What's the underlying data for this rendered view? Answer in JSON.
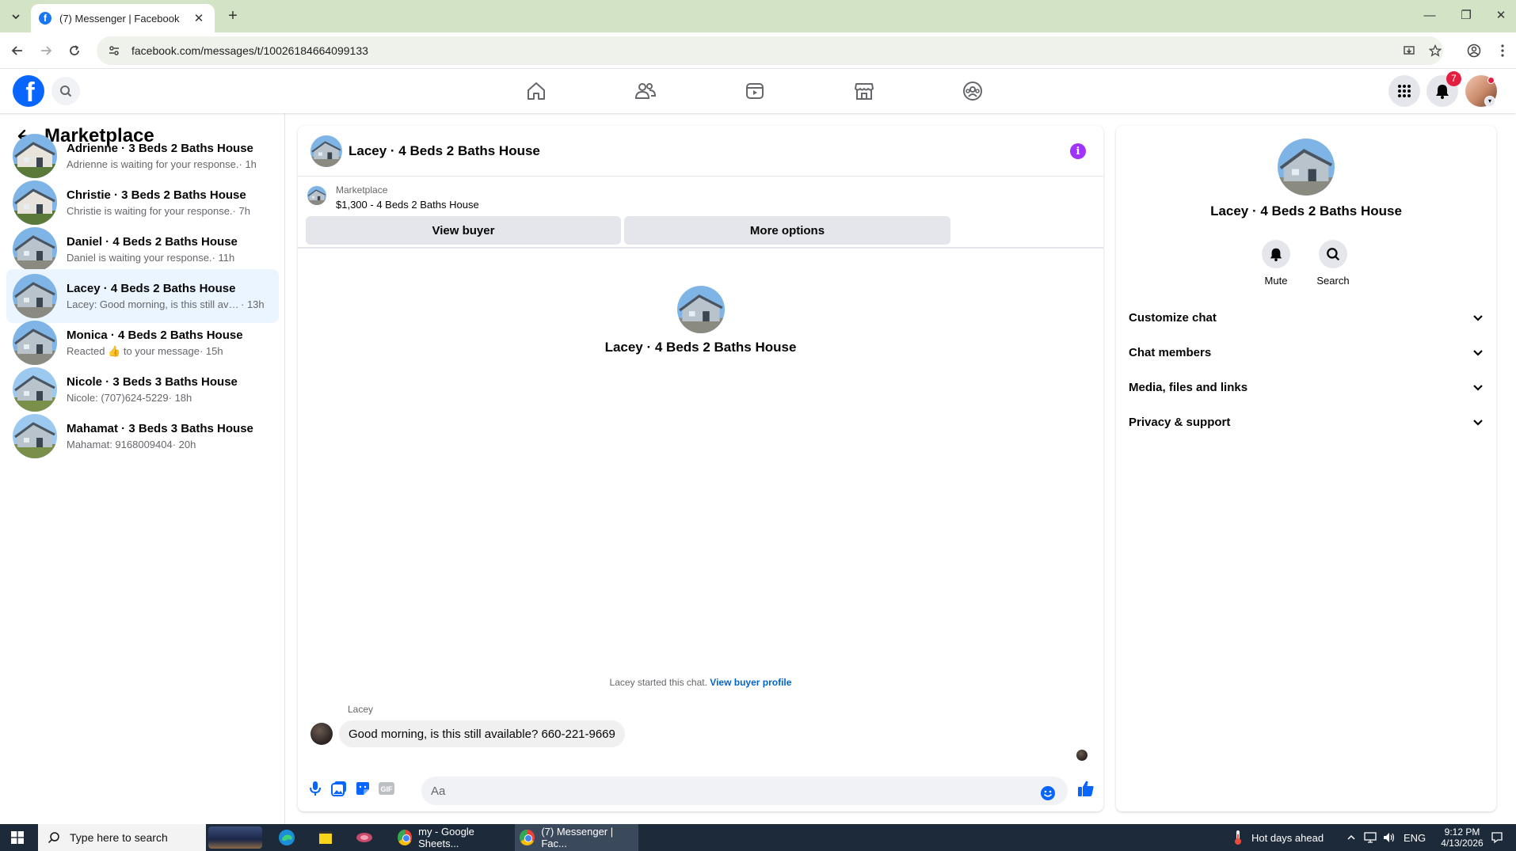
{
  "browser": {
    "tab_title": "(7) Messenger | Facebook",
    "tab_favicon": "f",
    "url": "facebook.com/messages/t/10026184664099133"
  },
  "fb_header": {
    "logo_letter": "f",
    "notification_count": "7"
  },
  "sidebar": {
    "title": "Marketplace",
    "conversations": [
      {
        "name": "Adrienne · 3 Beds 2 Baths House",
        "preview": "Adrienne is waiting for your response.",
        "time": " · 1h",
        "active": false
      },
      {
        "name": "Christie · 3 Beds 2 Baths House",
        "preview": "Christie is waiting for your response.",
        "time": " · 7h",
        "active": false
      },
      {
        "name": "Daniel · 4 Beds 2 Baths House",
        "preview": "Daniel is waiting your response.",
        "time": " · 11h",
        "active": false
      },
      {
        "name": "Lacey · 4 Beds 2 Baths House",
        "preview": "Lacey: Good morning, is this still avai...",
        "time": " · 13h",
        "active": true
      },
      {
        "name": "Monica · 4 Beds 2 Baths House",
        "preview": "Reacted 👍 to your message",
        "time": " · 15h",
        "active": false
      },
      {
        "name": "Nicole · 3 Beds 3 Baths House",
        "preview": "Nicole: (707)624-5229",
        "time": " · 18h",
        "active": false
      },
      {
        "name": "Mahamat · 3 Beds 3 Baths House",
        "preview": "Mahamat: 9168009404",
        "time": " · 20h",
        "active": false
      }
    ]
  },
  "chat": {
    "title": "Lacey · 4 Beds 2 Baths House",
    "marketplace_label": "Marketplace",
    "listing": "$1,300 - 4 Beds 2 Baths House",
    "view_buyer_label": "View buyer",
    "more_options_label": "More options",
    "intro_name": "Lacey · 4 Beds 2 Baths House",
    "started_text": "Lacey started this chat.",
    "view_profile_label": "View buyer profile",
    "sender": "Lacey",
    "message": "Good morning, is this still available? 660-221-9669",
    "input_placeholder": "Aa",
    "gif_label": "GIF"
  },
  "info_panel": {
    "name": "Lacey · 4 Beds 2 Baths House",
    "mute_label": "Mute",
    "search_label": "Search",
    "sections": [
      "Customize chat",
      "Chat members",
      "Media, files and links",
      "Privacy & support"
    ]
  },
  "taskbar": {
    "search_placeholder": "Type here to search",
    "window1": "my - Google Sheets...",
    "window2": "(7) Messenger | Fac...",
    "weather": "Hot days ahead",
    "lang": "ENG",
    "time": "9:12 PM",
    "date": "4/13/2026"
  },
  "colors": {
    "fb_blue": "#0866ff",
    "active_row": "#ebf5ff",
    "info_purple": "#a033ff",
    "badge_red": "#e41e3f",
    "tab_strip": "#d3e3c6"
  }
}
